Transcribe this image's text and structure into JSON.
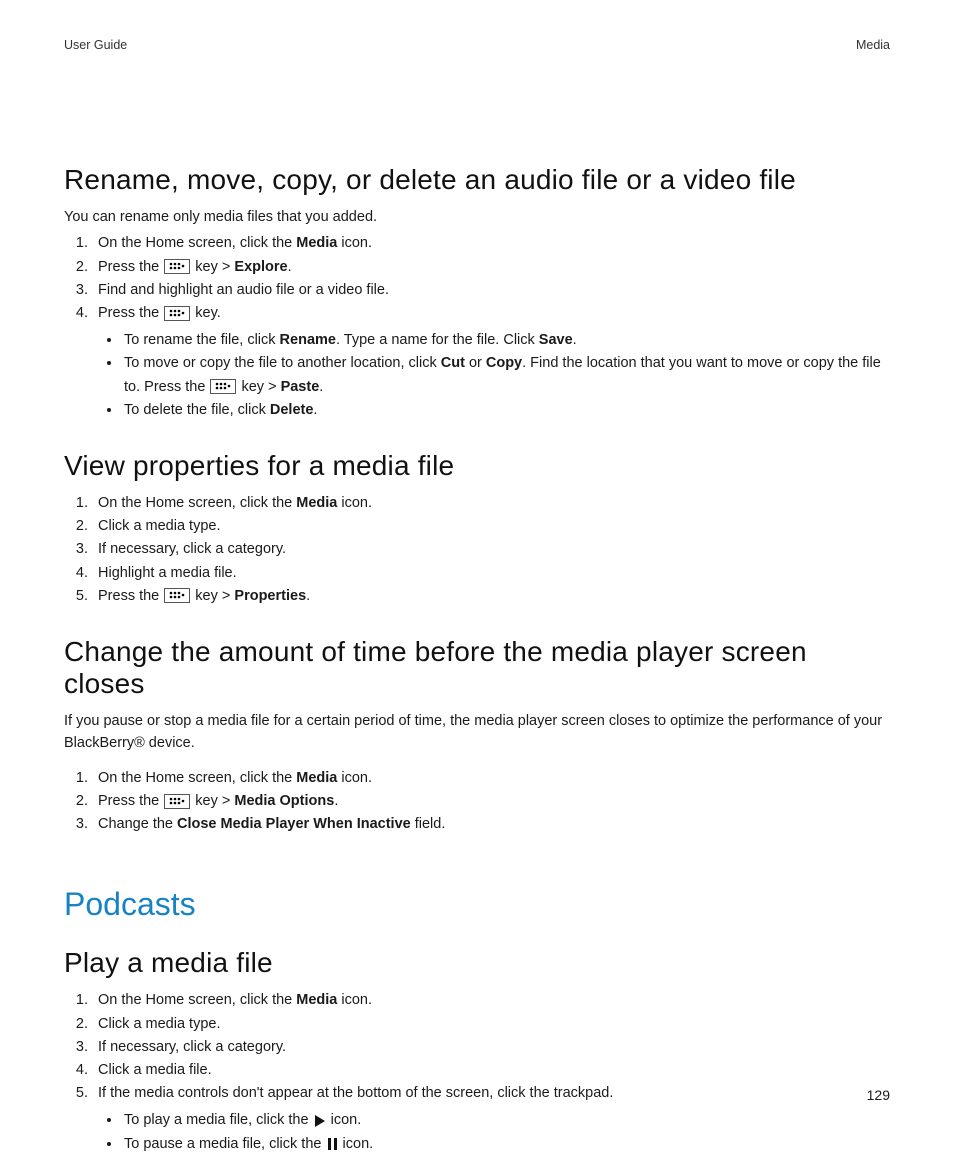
{
  "header": {
    "left": "User Guide",
    "right": "Media"
  },
  "s1": {
    "title": "Rename, move, copy, or delete an audio file or a video file",
    "intro": "You can rename only media files that you added.",
    "step1a": "On the Home screen, click the ",
    "step1b": "Media",
    "step1c": " icon.",
    "step2a": "Press the ",
    "step2b": " key > ",
    "step2c": "Explore",
    "step2d": ".",
    "step3": "Find and highlight an audio file or a video file.",
    "step4a": "Press the ",
    "step4b": " key.",
    "sub1a": "To rename the file, click ",
    "sub1b": "Rename",
    "sub1c": ". Type a name for the file. Click ",
    "sub1d": "Save",
    "sub1e": ".",
    "sub2a": "To move or copy the file to another location, click ",
    "sub2b": "Cut",
    "sub2c": " or ",
    "sub2d": "Copy",
    "sub2e": ". Find the location that you want to move or copy the file to. Press the ",
    "sub2f": " key > ",
    "sub2g": "Paste",
    "sub2h": ".",
    "sub3a": "To delete the file, click ",
    "sub3b": "Delete",
    "sub3c": "."
  },
  "s2": {
    "title": "View properties for a media file",
    "step1a": "On the Home screen, click the ",
    "step1b": "Media",
    "step1c": " icon.",
    "step2": "Click a media type.",
    "step3": "If necessary, click a category.",
    "step4": "Highlight a media file.",
    "step5a": "Press the ",
    "step5b": " key > ",
    "step5c": "Properties",
    "step5d": "."
  },
  "s3": {
    "title": "Change the amount of time before the media player screen closes",
    "intro": "If you pause or stop a media file for a certain period of time, the media player screen closes to optimize the performance of your BlackBerry® device.",
    "step1a": "On the Home screen, click the ",
    "step1b": "Media",
    "step1c": " icon.",
    "step2a": "Press the ",
    "step2b": " key > ",
    "step2c": "Media Options",
    "step2d": ".",
    "step3a": "Change the ",
    "step3b": "Close Media Player When Inactive",
    "step3c": " field."
  },
  "section2": {
    "title": "Podcasts"
  },
  "s4": {
    "title": "Play a media file",
    "step1a": "On the Home screen, click the ",
    "step1b": "Media",
    "step1c": " icon.",
    "step2": "Click a media type.",
    "step3": "If necessary, click a category.",
    "step4": "Click a media file.",
    "step5": "If the media controls don't appear at the bottom of the screen, click the trackpad.",
    "sub1a": "To play a media file, click the ",
    "sub1b": " icon.",
    "sub2a": "To pause a media file, click the ",
    "sub2b": " icon."
  },
  "footer": {
    "page": "129"
  }
}
